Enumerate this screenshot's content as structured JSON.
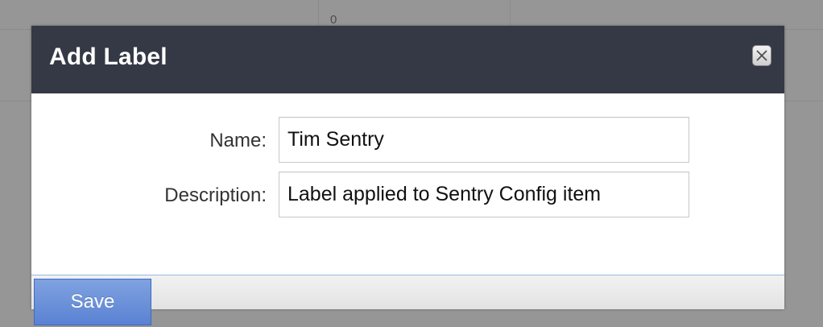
{
  "background": {
    "cell_text": "0"
  },
  "dialog": {
    "title": "Add Label",
    "close_icon": "close-icon",
    "fields": [
      {
        "label": "Name:",
        "value": "Tim Sentry",
        "placeholder": ""
      },
      {
        "label": "Description:",
        "value": "Label applied to Sentry Config item",
        "placeholder": ""
      }
    ],
    "save_label": "Save"
  },
  "colors": {
    "header_bg": "#343945",
    "overlay": "#5c5c5c",
    "save_button": "#5a82d3",
    "footer_border": "#99b8e2"
  }
}
